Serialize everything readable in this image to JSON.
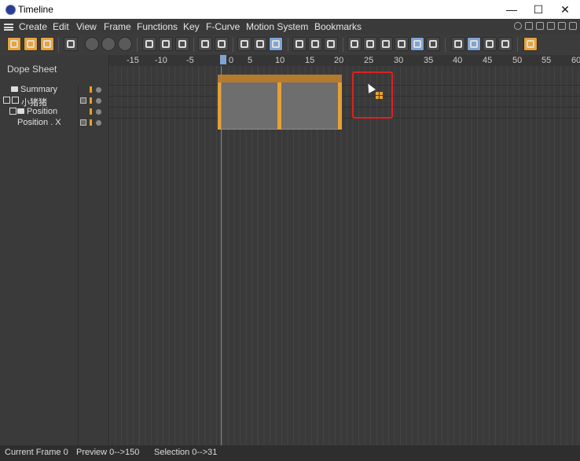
{
  "window": {
    "title": "Timeline",
    "minimize": "—",
    "maximize": "☐",
    "close": "✕"
  },
  "menu": [
    "Create",
    "Edit",
    "View",
    "Frame",
    "Functions",
    "Key",
    "F-Curve",
    "Motion System",
    "Bookmarks"
  ],
  "panel": {
    "label": "Dope Sheet",
    "tree": [
      {
        "label": "Summary"
      },
      {
        "label": "小猪猪"
      },
      {
        "label": "Position"
      },
      {
        "label": "Position . X"
      }
    ]
  },
  "ruler": {
    "ticks": [
      "-15",
      "-10",
      "-5",
      "0",
      "5",
      "10",
      "15",
      "20",
      "25",
      "30",
      "35",
      "40",
      "45",
      "50",
      "55",
      "60"
    ]
  },
  "status": {
    "current_frame": "Current Frame  0",
    "preview": "Preview  0-->150",
    "selection": "Selection 0-->31"
  },
  "colors": {
    "accent": "#e7a034",
    "highlight_box": "#e02020",
    "playhead": "#7fa4d4"
  }
}
